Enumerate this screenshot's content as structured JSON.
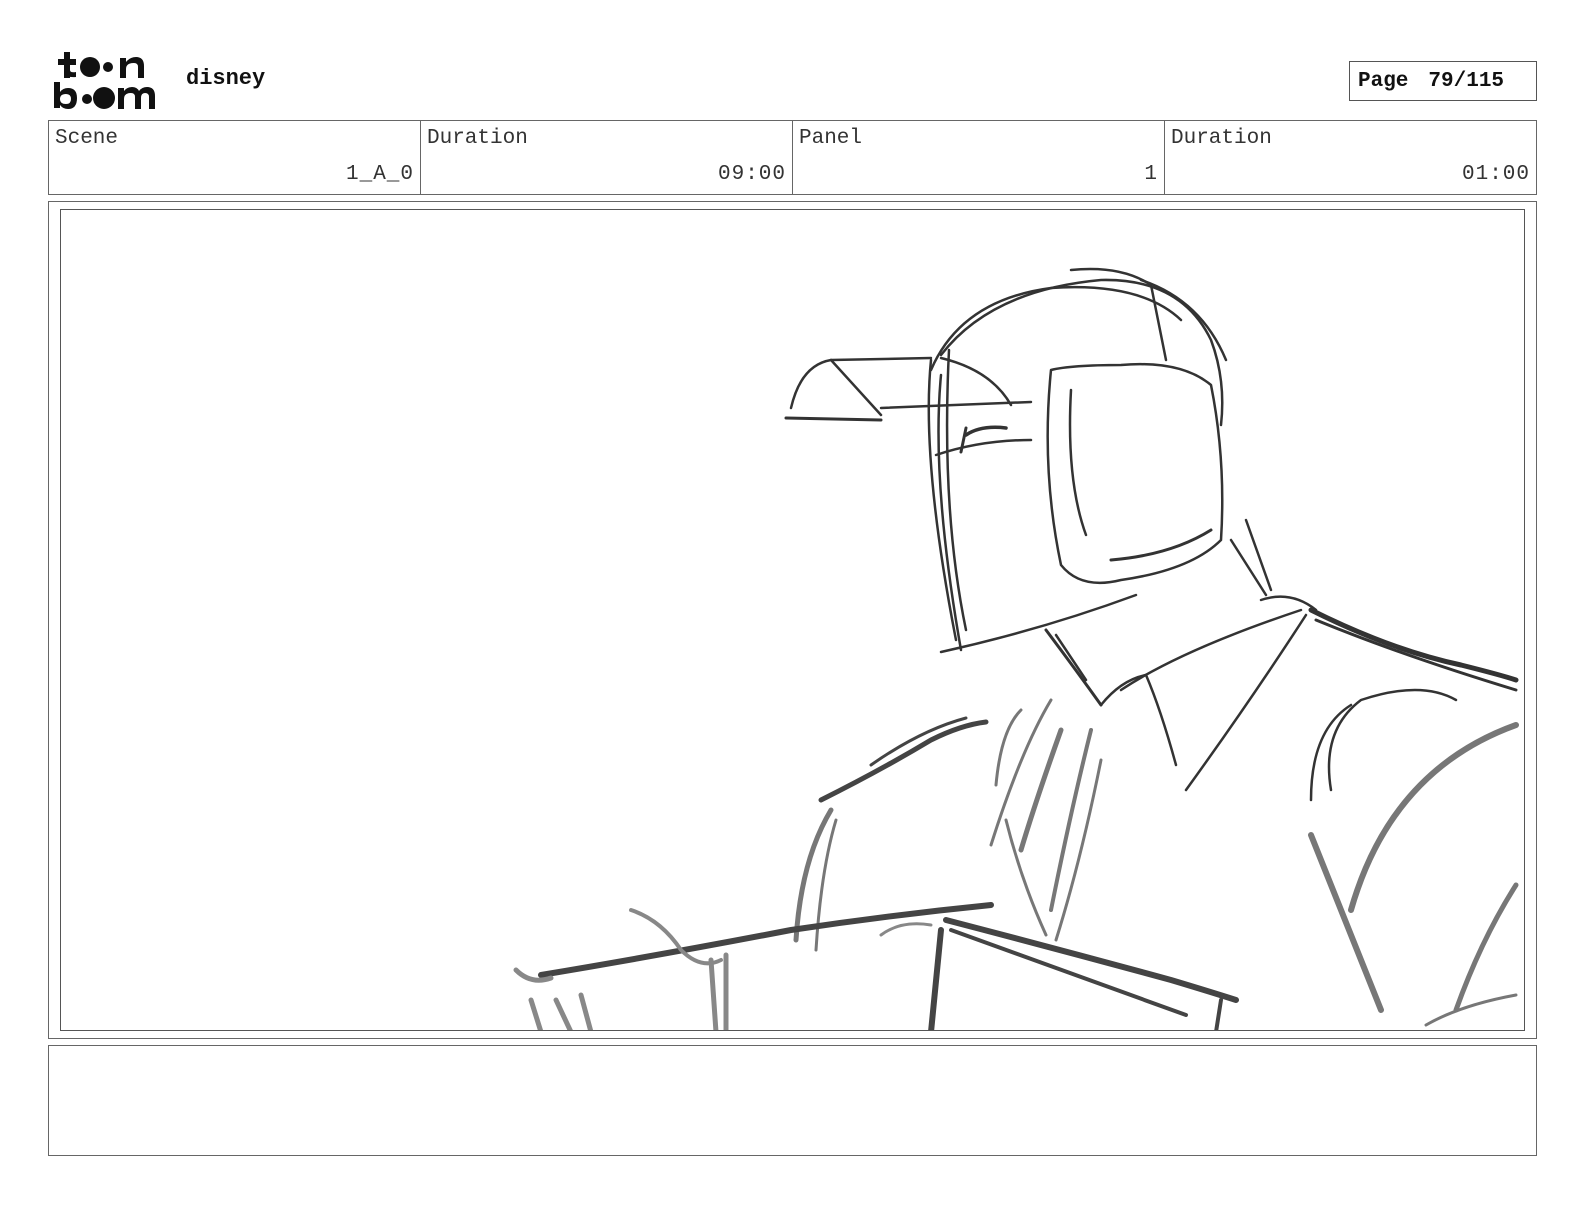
{
  "header": {
    "logo": {
      "text_line1": "toon",
      "text_line2": "boom"
    },
    "project_name": "disney",
    "page_label": "Page",
    "page_value": "79/115"
  },
  "info": {
    "scene_label": "Scene",
    "scene_value": "1_A_0",
    "scene_duration_label": "Duration",
    "scene_duration_value": "09:00",
    "panel_label": "Panel",
    "panel_value": "1",
    "panel_duration_label": "Duration",
    "panel_duration_value": "01:00"
  },
  "panel": {
    "image": "rough-pencil-sketch-man-with-headphones-at-desk"
  },
  "notes": {
    "text": ""
  }
}
